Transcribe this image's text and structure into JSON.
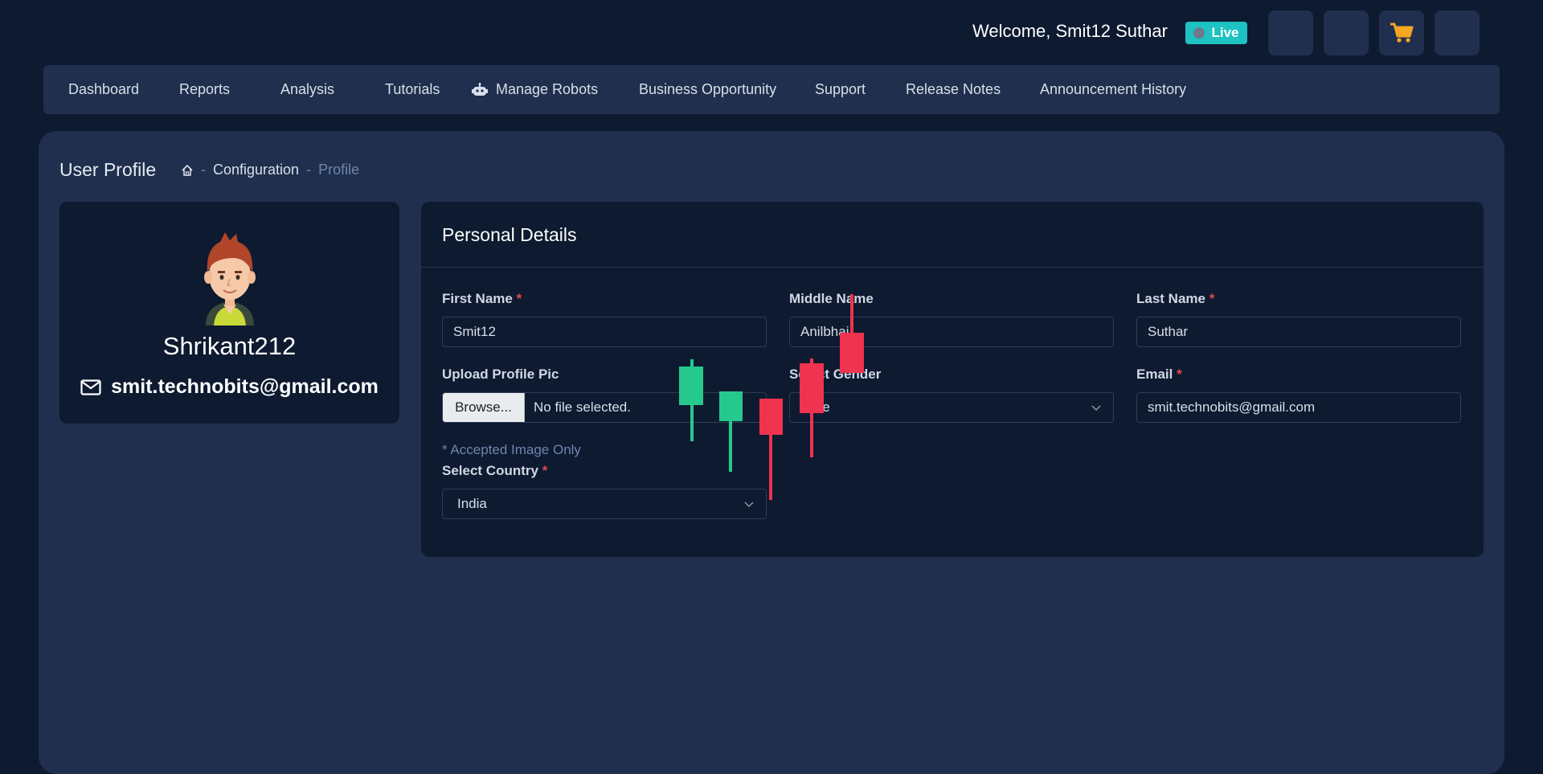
{
  "header": {
    "welcome_text": "Welcome, Smit12 Suthar",
    "live_label": "Live",
    "icons": [
      "blank-icon",
      "blank-icon",
      "cart-icon",
      "blank-icon"
    ],
    "accent_color": "#1ec2c2",
    "cart_color": "#f5a623"
  },
  "nav": {
    "items": [
      {
        "label": "Dashboard"
      },
      {
        "label": "Reports"
      },
      {
        "label": "Analysis"
      },
      {
        "label": "Tutorials"
      },
      {
        "label": "Manage Robots",
        "icon": "robot-icon"
      },
      {
        "label": "Business Opportunity"
      },
      {
        "label": "Support"
      },
      {
        "label": "Release Notes"
      },
      {
        "label": "Announcement History"
      }
    ]
  },
  "page": {
    "title": "User Profile",
    "breadcrumb": {
      "home_icon": "home-icon",
      "separator": "-",
      "items": [
        "Configuration",
        "Profile"
      ]
    }
  },
  "profile": {
    "name": "Shrikant212",
    "email": "smit.technobits@gmail.com",
    "email_icon": "envelope-icon"
  },
  "details": {
    "title": "Personal Details",
    "required_marker": "*",
    "first_name": {
      "label": "First Name",
      "value": "Smit12"
    },
    "middle_name": {
      "label": "Middle Name",
      "value": "Anilbhai"
    },
    "last_name": {
      "label": "Last Name",
      "value": "Suthar"
    },
    "upload": {
      "label": "Upload Profile Pic",
      "button": "Browse...",
      "status": "No file selected.",
      "help": "* Accepted Image Only"
    },
    "gender": {
      "label": "Select Gender",
      "value": "Male"
    },
    "email": {
      "label": "Email",
      "value": "smit.technobits@gmail.com"
    },
    "country": {
      "label": "Select Country",
      "value": "India"
    }
  },
  "overlay": {
    "candles": [
      {
        "color": "#26c98d"
      },
      {
        "color": "#26c98d"
      },
      {
        "color": "#f0334f"
      },
      {
        "color": "#f0334f"
      },
      {
        "color": "#f0334f"
      }
    ]
  }
}
